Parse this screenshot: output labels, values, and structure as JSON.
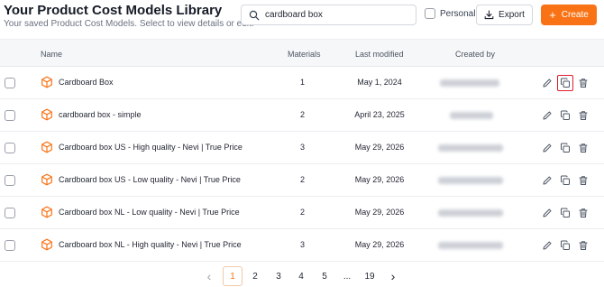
{
  "header": {
    "title": "Your Product Cost Models Library",
    "subtitle": "Your saved Product Cost Models. Select to view details or edit."
  },
  "search": {
    "value": "cardboard box",
    "icon": "search-icon"
  },
  "filters": {
    "personal_label": "Personal",
    "personal_checked": false
  },
  "buttons": {
    "export_label": "Export",
    "create_label": "Create",
    "create_color": "#f97316"
  },
  "table": {
    "columns": [
      "Name",
      "Materials",
      "Last modified",
      "Created by"
    ],
    "rows": [
      {
        "name": "Cardboard Box",
        "materials": "1",
        "modified": "May 1, 2024"
      },
      {
        "name": "cardboard box - simple",
        "materials": "2",
        "modified": "April 23, 2025"
      },
      {
        "name": "Cardboard box US - High quality - Nevi | True Price",
        "materials": "3",
        "modified": "May 29, 2026"
      },
      {
        "name": "Cardboard box US - Low quality - Nevi | True Price",
        "materials": "2",
        "modified": "May 29, 2026"
      },
      {
        "name": "Cardboard box NL - Low quality - Nevi | True Price",
        "materials": "2",
        "modified": "May 29, 2026"
      },
      {
        "name": "Cardboard box NL - High quality - Nevi | True Price",
        "materials": "3",
        "modified": "May 29, 2026"
      }
    ]
  },
  "pagination": {
    "prev": "‹",
    "pages": [
      "1",
      "2",
      "3",
      "4",
      "5",
      "...",
      "19"
    ],
    "next": "›",
    "current": "1"
  }
}
